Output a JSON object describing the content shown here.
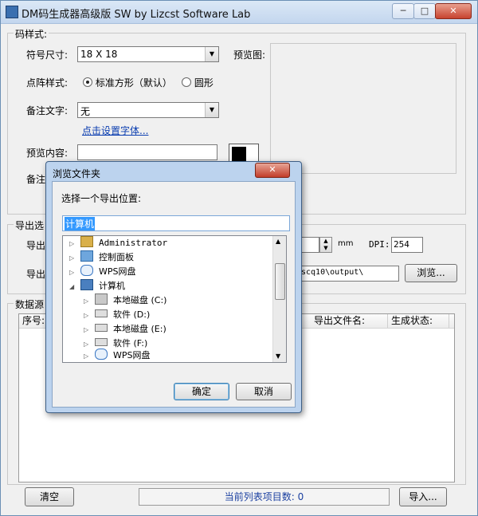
{
  "window": {
    "title": "DM码生成器高级版 SW  by Lizcst Software Lab"
  },
  "code_style": {
    "group_label": "码样式:",
    "symbol_size_label": "符号尺寸:",
    "symbol_size_value": "18 X 18",
    "preview_label": "预览图:",
    "dot_style_label": "点阵样式:",
    "dot_style_option1": "标准方形（默认）",
    "dot_style_option2": "圆形",
    "note_text_label": "备注文字:",
    "note_text_value": "无",
    "font_link": "点击设置字体...",
    "preview_content_label": "预览内容:",
    "note_label_partial": "备注"
  },
  "export": {
    "group_label_partial": "导出选",
    "size_label_partial": "导出",
    "unit": "mm",
    "dpi_label": "DPI:",
    "dpi_value": "254",
    "path_label_partial": "导出",
    "path_value_partial": "scq10\\output\\",
    "browse_button": "浏览..."
  },
  "data_source": {
    "group_label_partial": "数据源",
    "columns": [
      "序号:",
      "导出文件名:",
      "生成状态:"
    ]
  },
  "footer": {
    "clear_button": "清空",
    "status_text": "当前列表项目数: 0",
    "import_button": "导入..."
  },
  "dialog": {
    "title": "浏览文件夹",
    "prompt": "选择一个导出位置:",
    "selected_path": "计算机",
    "tree": [
      {
        "label": "Administrator",
        "icon": "user-folder-icon",
        "expanded": false
      },
      {
        "label": "控制面板",
        "icon": "control-panel-icon",
        "expanded": false
      },
      {
        "label": "WPS网盘",
        "icon": "cloud-drive-icon",
        "expanded": false
      },
      {
        "label": "计算机",
        "icon": "computer-icon",
        "expanded": true
      },
      {
        "label": "本地磁盘 (C:)",
        "icon": "system-drive-icon",
        "expanded": false
      },
      {
        "label": "软件 (D:)",
        "icon": "drive-icon",
        "expanded": false
      },
      {
        "label": "本地磁盘 (E:)",
        "icon": "drive-icon",
        "expanded": false
      },
      {
        "label": "软件 (F:)",
        "icon": "drive-icon",
        "expanded": false
      },
      {
        "label": "WPS网盘",
        "icon": "cloud-drive-icon",
        "expanded": false
      }
    ],
    "ok_button": "确定",
    "cancel_button": "取消",
    "close_button": "✕"
  }
}
